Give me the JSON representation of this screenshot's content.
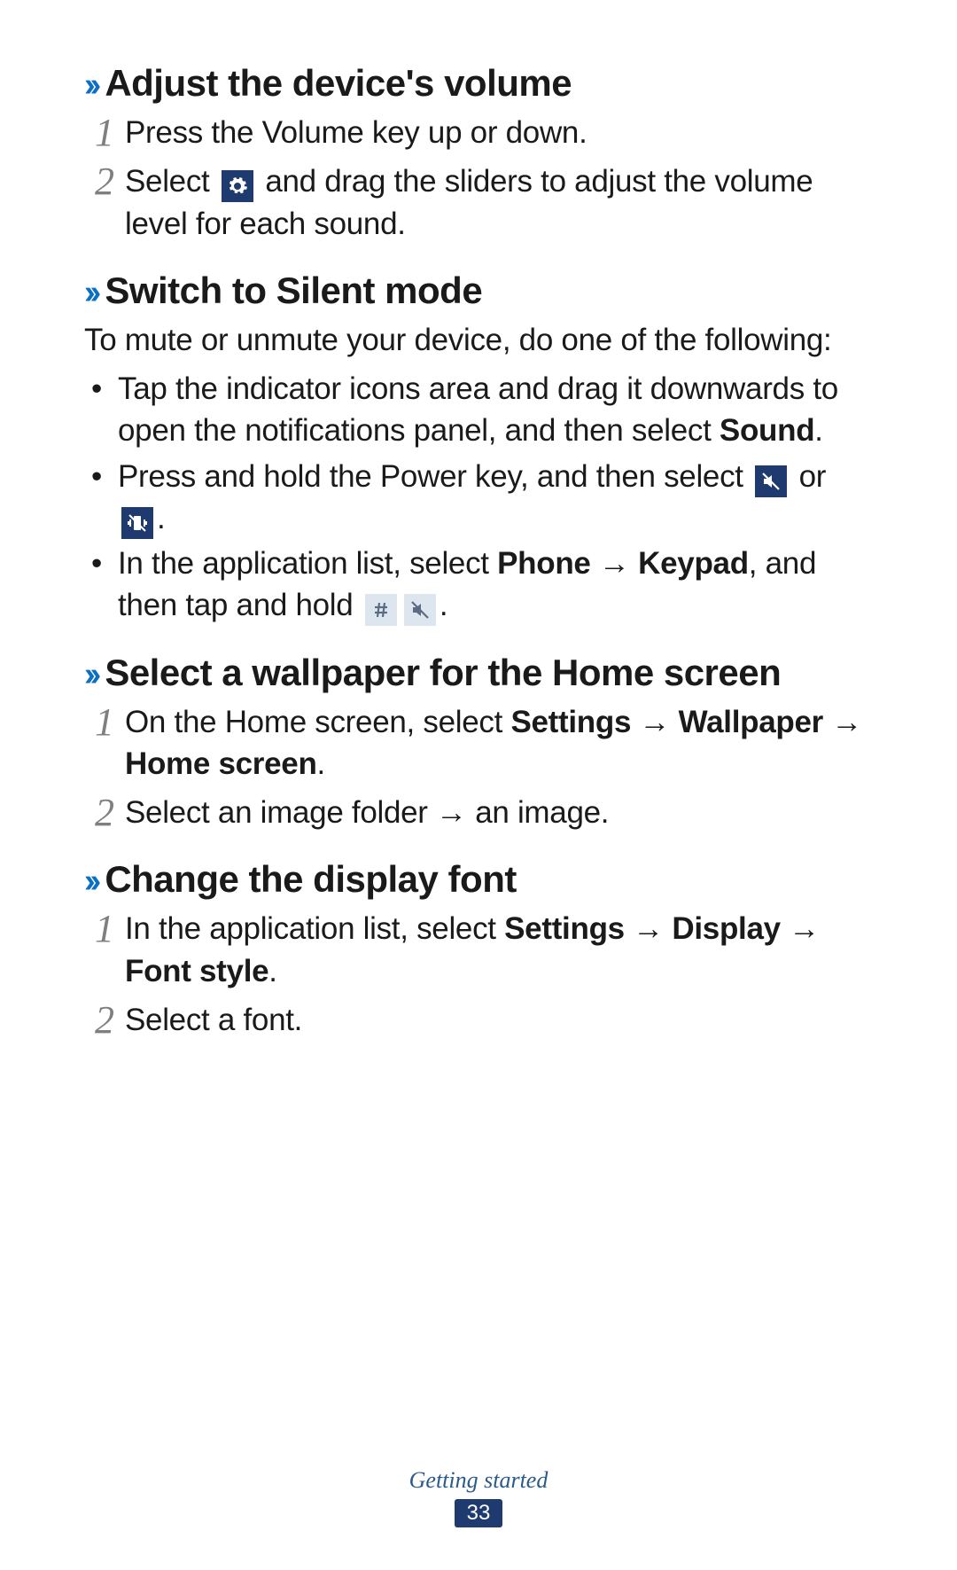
{
  "sections": [
    {
      "heading": "Adjust the device's volume",
      "steps": [
        {
          "num": "1",
          "text": "Press the Volume key up or down."
        },
        {
          "num": "2",
          "prefix": "Select ",
          "icon": "gear",
          "suffix": " and drag the sliders to adjust the volume level for each sound."
        }
      ]
    },
    {
      "heading": "Switch to Silent mode",
      "intro": "To mute or unmute your device, do one of the following:",
      "bullets": [
        {
          "parts": [
            {
              "t": "Tap the indicator icons area and drag it downwards to open the notifications panel, and then select "
            },
            {
              "b": "Sound"
            },
            {
              "t": "."
            }
          ]
        },
        {
          "parts": [
            {
              "t": "Press and hold the Power key, and then select "
            },
            {
              "icon": "mute"
            },
            {
              "t": " or "
            },
            {
              "icon": "vibrate"
            },
            {
              "t": "."
            }
          ]
        },
        {
          "parts": [
            {
              "t": "In the application list, select "
            },
            {
              "b": "Phone"
            },
            {
              "t": " → "
            },
            {
              "b": "Keypad"
            },
            {
              "t": ", and then tap and hold "
            },
            {
              "icon": "hash",
              "light": true
            },
            {
              "icon": "mute2",
              "light": true
            },
            {
              "t": "."
            }
          ]
        }
      ]
    },
    {
      "heading": "Select a wallpaper for the Home screen",
      "steps": [
        {
          "num": "1",
          "parts": [
            {
              "t": "On the Home screen, select "
            },
            {
              "b": "Settings"
            },
            {
              "t": " → "
            },
            {
              "b": "Wallpaper"
            },
            {
              "t": " → "
            },
            {
              "b": "Home screen"
            },
            {
              "t": "."
            }
          ]
        },
        {
          "num": "2",
          "text": "Select an image folder → an image."
        }
      ]
    },
    {
      "heading": "Change the display font",
      "steps": [
        {
          "num": "1",
          "parts": [
            {
              "t": "In the application list, select "
            },
            {
              "b": "Settings"
            },
            {
              "t": " → "
            },
            {
              "b": "Display"
            },
            {
              "t": " → "
            },
            {
              "b": "Font style"
            },
            {
              "t": "."
            }
          ]
        },
        {
          "num": "2",
          "text": "Select a font."
        }
      ]
    }
  ],
  "footer": {
    "section": "Getting started",
    "page": "33"
  },
  "chevron": "››"
}
